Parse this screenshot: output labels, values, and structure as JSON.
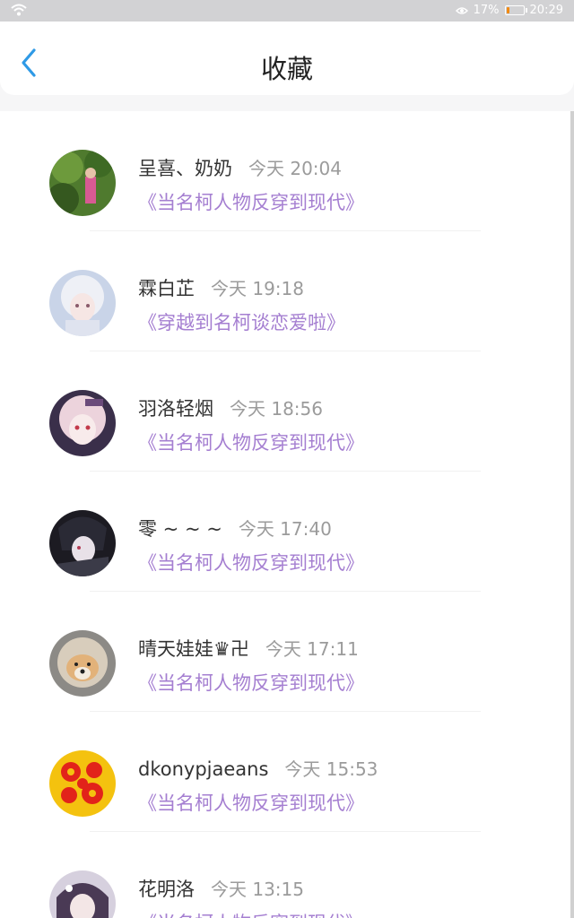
{
  "status_bar": {
    "battery": "17%",
    "time": "20:29",
    "battery_level": 0.17
  },
  "header": {
    "title": "收藏"
  },
  "favorites": [
    {
      "name": "呈喜、奶奶",
      "time": "今天 20:04",
      "story": "《当名柯人物反穿到现代》",
      "avatar": "avatar-photo-garden"
    },
    {
      "name": "霖白芷",
      "time": "今天 19:18",
      "story": "《穿越到名柯谈恋爱啦》",
      "avatar": "avatar-white-hair-girl"
    },
    {
      "name": "羽洛轻烟",
      "time": "今天 18:56",
      "story": "《当名柯人物反穿到现代》",
      "avatar": "avatar-anime-girl-pink"
    },
    {
      "name": "零 ~ ~ ~",
      "time": "今天 17:40",
      "story": "《当名柯人物反穿到现代》",
      "avatar": "avatar-dark-anime-boy"
    },
    {
      "name": "晴天娃娃♛卍",
      "time": "今天 17:11",
      "story": "《当名柯人物反穿到现代》",
      "avatar": "avatar-shiba-dog"
    },
    {
      "name": "dkonypjaeans",
      "time": "今天 15:53",
      "story": "《当名柯人物反穿到现代》",
      "avatar": "avatar-red-flower-pattern"
    },
    {
      "name": "花明洛",
      "time": "今天 13:15",
      "story": "《当名柯人物反穿到现代》",
      "avatar": "avatar-anime-girl-purple"
    }
  ]
}
